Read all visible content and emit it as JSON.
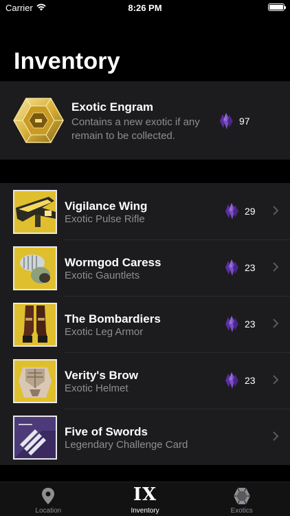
{
  "status_bar": {
    "carrier": "Carrier",
    "time": "8:26 PM",
    "battery_level": 1.0
  },
  "page_title": "Inventory",
  "engram": {
    "title": "Exotic Engram",
    "description": "Contains a new exotic if any remain to be collected.",
    "cost": "97",
    "icon": "exotic-engram-icon"
  },
  "items": [
    {
      "name": "Vigilance Wing",
      "type": "Exotic Pulse Rifle",
      "cost": "29",
      "icon": "pulse-rifle-thumb"
    },
    {
      "name": "Wormgod Caress",
      "type": "Exotic Gauntlets",
      "cost": "23",
      "icon": "gauntlets-thumb"
    },
    {
      "name": "The Bombardiers",
      "type": "Exotic Leg Armor",
      "cost": "23",
      "icon": "leg-armor-thumb"
    },
    {
      "name": "Verity's Brow",
      "type": "Exotic Helmet",
      "cost": "23",
      "icon": "helmet-thumb"
    },
    {
      "name": "Five of Swords",
      "type": "Legendary Challenge Card",
      "cost": "",
      "icon": "challenge-card-thumb"
    }
  ],
  "tabs": [
    {
      "label": "Location",
      "icon": "location-pin-icon",
      "active": false
    },
    {
      "label": "Inventory",
      "icon": "roman-ix-icon",
      "glyph": "IX",
      "active": true
    },
    {
      "label": "Exotics",
      "icon": "exotic-engram-icon",
      "active": false
    }
  ],
  "colors": {
    "background": "#000000",
    "card": "#1c1c1e",
    "secondary_text": "#8e8e93",
    "exotic_gold": "#d9b73b",
    "shard_purple": "#6b3fb0"
  }
}
